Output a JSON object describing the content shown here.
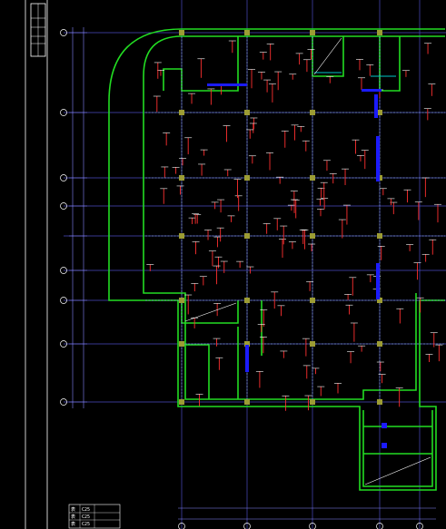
{
  "colors": {
    "background": "#000000",
    "wall": "#22dd22",
    "column": "#9c9c34",
    "axis": "#5555cc",
    "dim": "#8888ff",
    "beam_label": "#ff3030",
    "text": "#ffffff",
    "accent_blue": "#1b1bff",
    "cyan": "#00c8c8"
  },
  "legend_table": {
    "rows": [
      [
        "表",
        "C25"
      ],
      [
        "表",
        "C25"
      ],
      [
        "表",
        "C25"
      ]
    ]
  },
  "icons": [
    "title-block-icon",
    "column-icon",
    "axis-bubble-icon"
  ]
}
